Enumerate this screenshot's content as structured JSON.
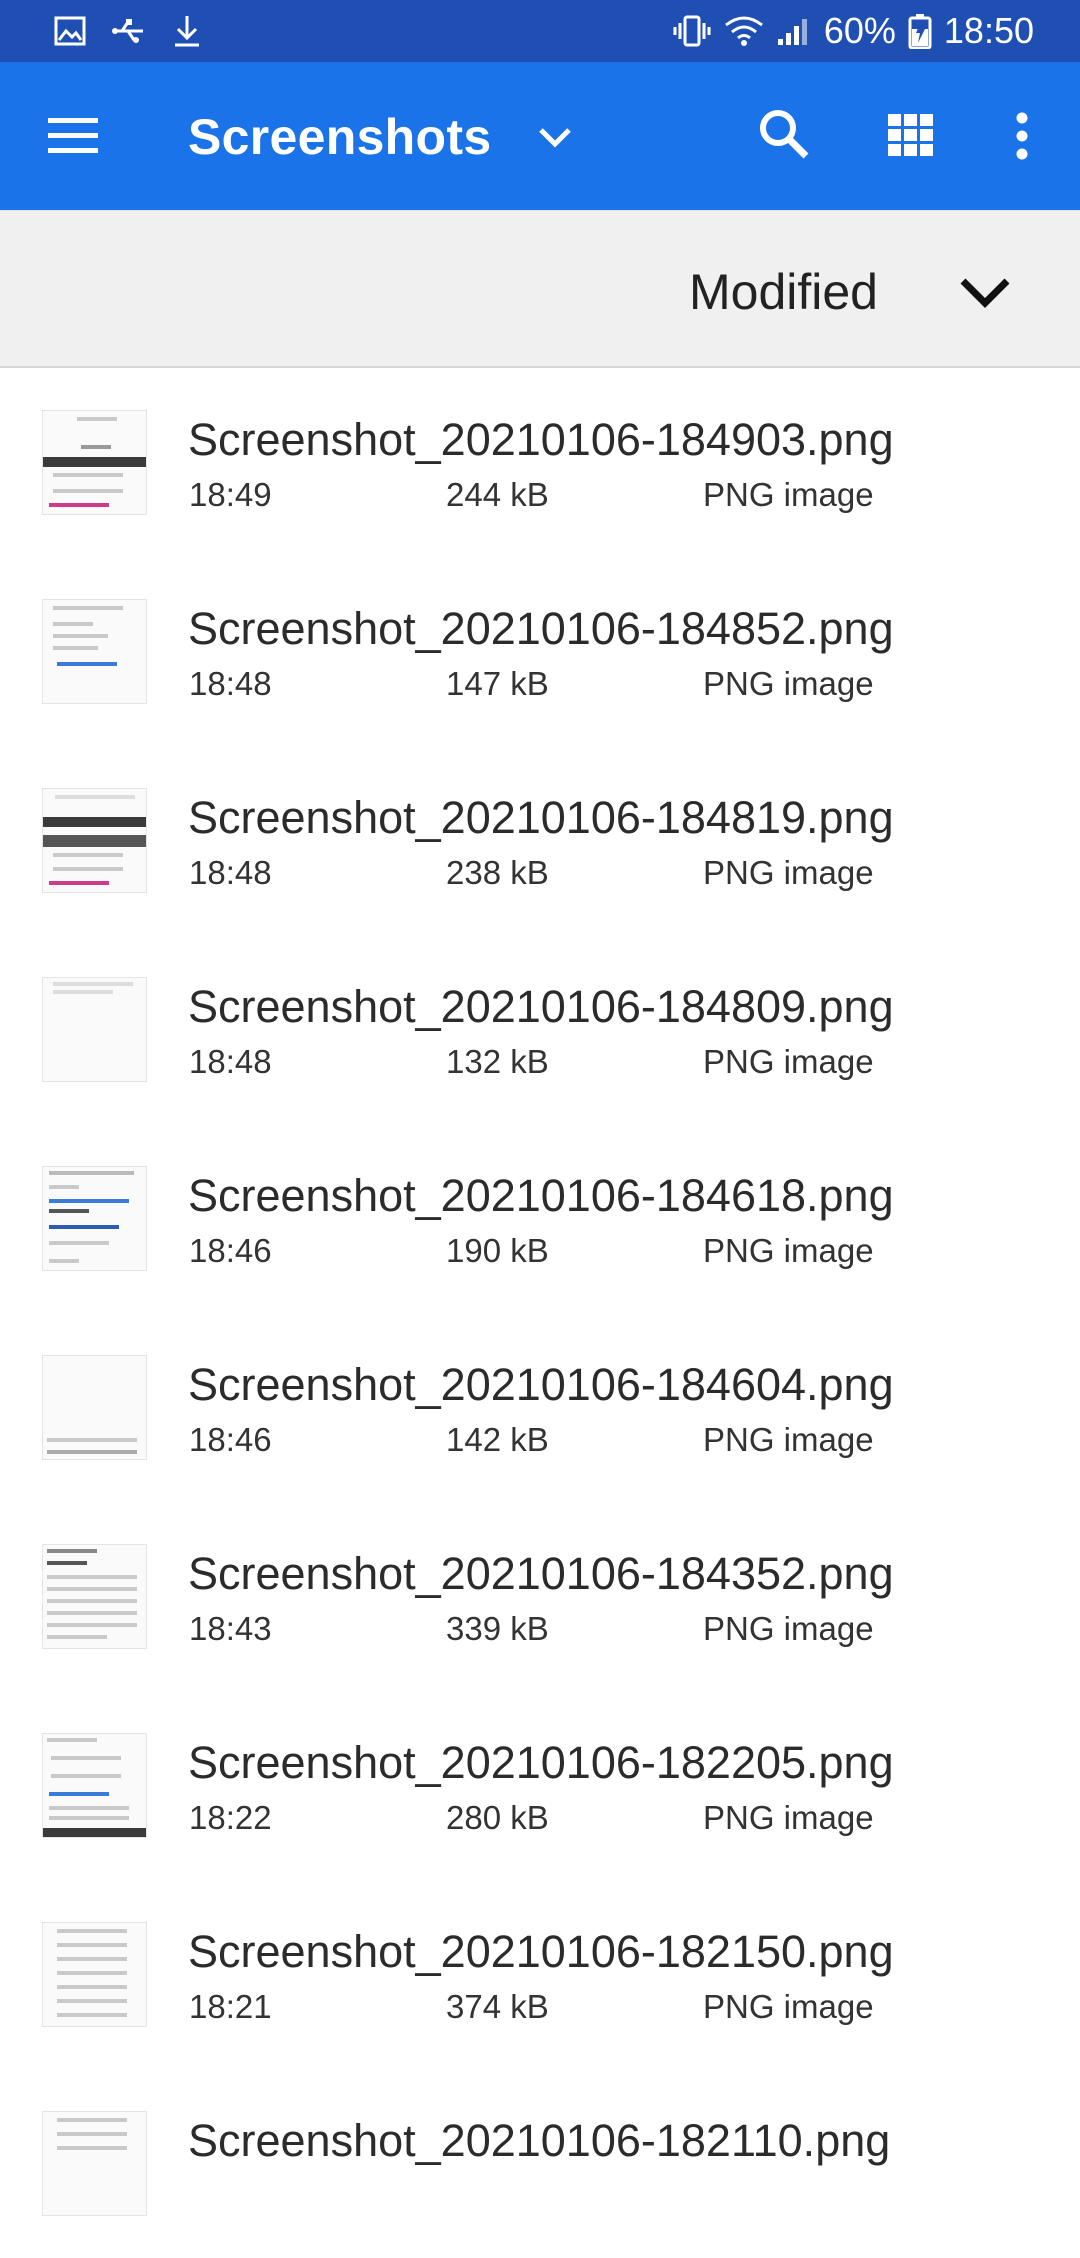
{
  "status_bar": {
    "battery": "60%",
    "time": "18:50",
    "left_icons": [
      "image-icon",
      "usb-icon",
      "download-icon"
    ],
    "right_icons": [
      "vibrate-icon",
      "wifi-icon",
      "signal-icon",
      "battery-icon"
    ]
  },
  "app_bar": {
    "title": "Screenshots",
    "icons": [
      "menu-icon",
      "chevron-down-icon",
      "search-icon",
      "grid-view-icon",
      "more-vert-icon"
    ],
    "color": "#1A73E8"
  },
  "sort_bar": {
    "label": "Modified"
  },
  "files": [
    {
      "name": "Screenshot_20210106-184903.png",
      "time": "18:49",
      "size": "244 kB",
      "type": "PNG image"
    },
    {
      "name": "Screenshot_20210106-184852.png",
      "time": "18:48",
      "size": "147 kB",
      "type": "PNG image"
    },
    {
      "name": "Screenshot_20210106-184819.png",
      "time": "18:48",
      "size": "238 kB",
      "type": "PNG image"
    },
    {
      "name": "Screenshot_20210106-184809.png",
      "time": "18:48",
      "size": "132 kB",
      "type": "PNG image"
    },
    {
      "name": "Screenshot_20210106-184618.png",
      "time": "18:46",
      "size": "190 kB",
      "type": "PNG image"
    },
    {
      "name": "Screenshot_20210106-184604.png",
      "time": "18:46",
      "size": "142 kB",
      "type": "PNG image"
    },
    {
      "name": "Screenshot_20210106-184352.png",
      "time": "18:43",
      "size": "339 kB",
      "type": "PNG image"
    },
    {
      "name": "Screenshot_20210106-182205.png",
      "time": "18:22",
      "size": "280 kB",
      "type": "PNG image"
    },
    {
      "name": "Screenshot_20210106-182150.png",
      "time": "18:21",
      "size": "374 kB",
      "type": "PNG image"
    },
    {
      "name": "Screenshot_20210106-182110.png",
      "time": "",
      "size": "",
      "type": ""
    }
  ]
}
